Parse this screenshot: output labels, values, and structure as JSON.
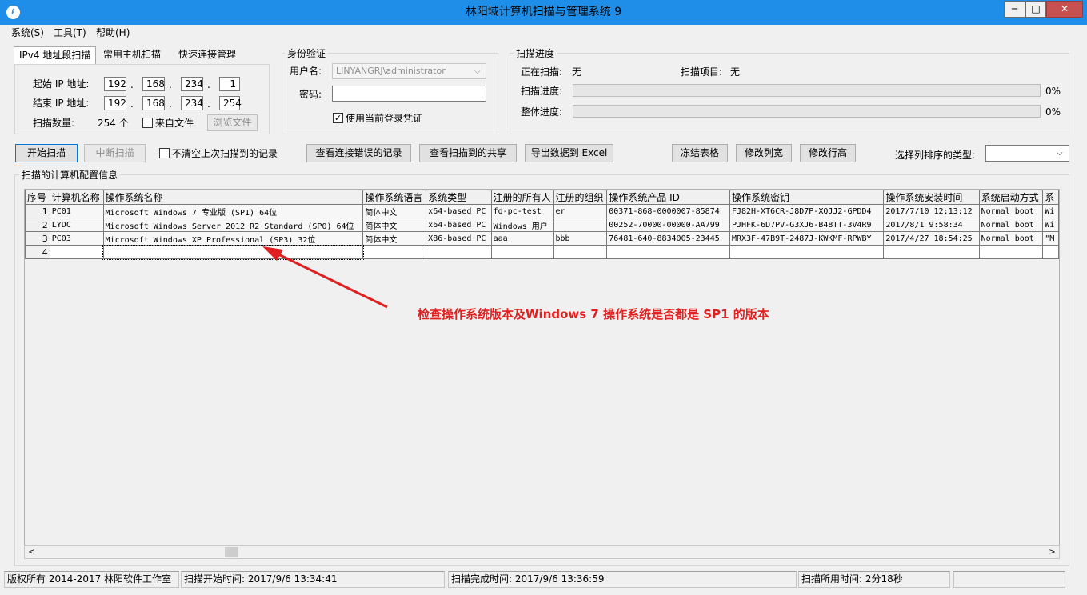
{
  "window": {
    "title": "林阳域计算机扫描与管理系统 9",
    "min": "─",
    "max": "□",
    "close": "✕"
  },
  "menu": [
    "系统(S)",
    "工具(T)",
    "帮助(H)"
  ],
  "tabs": [
    "IPv4 地址段扫描",
    "常用主机扫描",
    "快速连接管理"
  ],
  "ipv4": {
    "start_label": "起始 IP 地址:",
    "end_label": "结束 IP 地址:",
    "start": [
      "192",
      "168",
      "234",
      "1"
    ],
    "end": [
      "192",
      "168",
      "234",
      "254"
    ],
    "dot": ".",
    "count_label": "扫描数量:",
    "count_value": "254 个",
    "from_file_label": "来自文件",
    "browse_label": "浏览文件"
  },
  "auth": {
    "title": "身份验证",
    "user_label": "用户名:",
    "user_value": "LINYANGRJ\\administrator",
    "password_label": "密码:",
    "use_current_label": "使用当前登录凭证",
    "use_current_checked": true
  },
  "progress": {
    "title": "扫描进度",
    "scanning_label": "正在扫描:",
    "scanning_value": "无",
    "item_label": "扫描项目:",
    "item_value": "无",
    "scan_progress_label": "扫描进度:",
    "scan_progress_value": 0,
    "scan_progress_text": "0%",
    "total_progress_label": "整体进度:",
    "total_progress_value": 0,
    "total_progress_text": "0%"
  },
  "toolbar": {
    "start_scan": "开始扫描",
    "stop_scan": "中断扫描",
    "no_clear_label": "不清空上次扫描到的记录",
    "view_errors": "查看连接错误的记录",
    "view_shares": "查看扫描到的共享",
    "export_excel": "导出数据到 Excel",
    "freeze_table": "冻结表格",
    "edit_col_width": "修改列宽",
    "edit_row_height": "修改行高",
    "sort_type_label": "选择列排序的类型:",
    "sort_type_value": ""
  },
  "grid": {
    "title": "扫描的计算机配置信息",
    "columns": [
      "序号",
      "计算机名称",
      "操作系统名称",
      "操作系统语言",
      "系统类型",
      "注册的所有人",
      "注册的组织",
      "操作系统产品 ID",
      "操作系统密钥",
      "操作系统安装时间",
      "系统启动方式",
      "系"
    ],
    "rows": [
      [
        "1",
        "PC01",
        "Microsoft Windows 7 专业版 (SP1) 64位",
        "简体中文",
        "x64-based PC",
        "fd-pc-test",
        "er",
        "00371-868-0000007-85874",
        "FJ82H-XT6CR-J8D7P-XQJJ2-GPDD4",
        "2017/7/10 12:13:12",
        "Normal boot",
        "Wi"
      ],
      [
        "2",
        "LYDC",
        "Microsoft Windows Server 2012 R2 Standard (SP0) 64位",
        "简体中文",
        "x64-based PC",
        "Windows 用户",
        "",
        "00252-70000-00000-AA799",
        "PJHFK-6D7PV-G3XJ6-B48TT-3V4R9",
        "2017/8/1 9:58:34",
        "Normal boot",
        "Wi"
      ],
      [
        "3",
        "PC03",
        "Microsoft Windows XP Professional (SP3) 32位",
        "简体中文",
        "X86-based PC",
        "aaa",
        "bbb",
        "76481-640-8834005-23445",
        "MRX3F-47B9T-2487J-KWKMF-RPWBY",
        "2017/4/27 18:54:25",
        "Normal boot",
        "\"M"
      ],
      [
        "4",
        "",
        "",
        "",
        "",
        "",
        "",
        "",
        "",
        "",
        "",
        ""
      ]
    ]
  },
  "annotation": "检查操作系统版本及Windows 7 操作系统是否都是 SP1 的版本",
  "statusbar": {
    "copyright": "版权所有 2014-2017 林阳软件工作室",
    "scan_start": "扫描开始时间: 2017/9/6 13:34:41",
    "scan_end": "扫描完成时间: 2017/9/6 13:36:59",
    "elapsed": "扫描所用时间: 2分18秒"
  }
}
